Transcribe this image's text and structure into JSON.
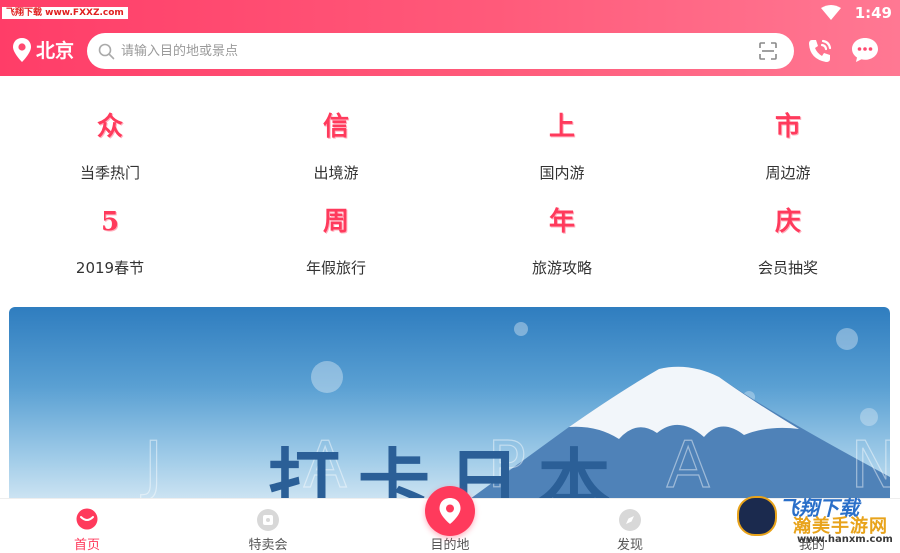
{
  "watermark_top": "飞翔下载 www.FXXZ.com",
  "status": {
    "time": "1:49"
  },
  "header": {
    "city": "北京",
    "search_placeholder": "请输入目的地或景点"
  },
  "categories": [
    {
      "glyph": "众",
      "label": "当季热门"
    },
    {
      "glyph": "信",
      "label": "出境游"
    },
    {
      "glyph": "上",
      "label": "国内游"
    },
    {
      "glyph": "市",
      "label": "周边游"
    },
    {
      "glyph": "5",
      "label": "2019春节"
    },
    {
      "glyph": "周",
      "label": "年假旅行"
    },
    {
      "glyph": "年",
      "label": "旅游攻略"
    },
    {
      "glyph": "庆",
      "label": "会员抽奖"
    }
  ],
  "banner": {
    "title": "打卡日本",
    "faint_text": "J A P A N"
  },
  "tabs": [
    {
      "label": "首页",
      "active": true
    },
    {
      "label": "特卖会"
    },
    {
      "label": "目的地"
    },
    {
      "label": "发现"
    },
    {
      "label": "我的"
    }
  ],
  "watermark_bottom": {
    "line1": "飞翔下载",
    "line2": "瀚美手游网",
    "url": "www.hanxm.com"
  },
  "colors": {
    "accent": "#ff3a5c",
    "header_start": "#ff3d68",
    "header_end": "#ff7893"
  }
}
